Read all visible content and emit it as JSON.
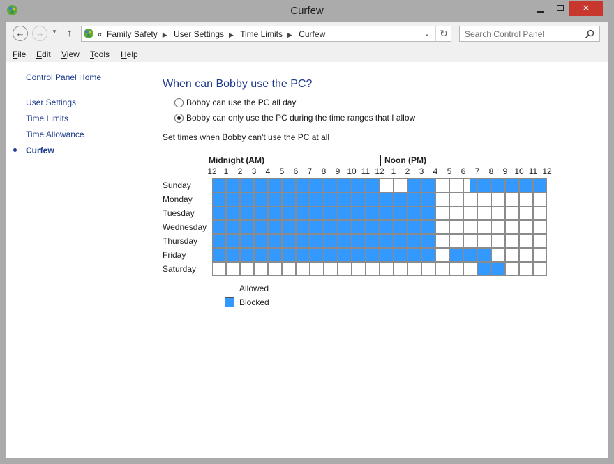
{
  "window": {
    "title": "Curfew"
  },
  "address_bar": {
    "breadcrumbs": [
      "«",
      "Family Safety",
      "User Settings",
      "Time Limits",
      "Curfew"
    ]
  },
  "search": {
    "placeholder": "Search Control Panel"
  },
  "menu": [
    {
      "key": "F",
      "rest": "ile"
    },
    {
      "key": "E",
      "rest": "dit"
    },
    {
      "key": "V",
      "rest": "iew"
    },
    {
      "key": "T",
      "rest": "ools"
    },
    {
      "key": "H",
      "rest": "elp"
    }
  ],
  "sidebar": {
    "home": "Control Panel Home",
    "items": [
      {
        "label": "User Settings",
        "active": false
      },
      {
        "label": "Time Limits",
        "active": false
      },
      {
        "label": "Time Allowance",
        "active": false
      },
      {
        "label": "Curfew",
        "active": true
      }
    ]
  },
  "main": {
    "heading": "When can Bobby use the PC?",
    "options": [
      {
        "label": "Bobby can use the PC all day",
        "selected": false
      },
      {
        "label": "Bobby can only use the PC during the time ranges that I allow",
        "selected": true
      }
    ],
    "instructions": "Set times when Bobby can't use the PC at all"
  },
  "schedule": {
    "am_label": "Midnight (AM)",
    "pm_label": "Noon (PM)",
    "hours": [
      "12",
      "1",
      "2",
      "3",
      "4",
      "5",
      "6",
      "7",
      "8",
      "9",
      "10",
      "11",
      "12",
      "1",
      "2",
      "3",
      "4",
      "5",
      "6",
      "7",
      "8",
      "9",
      "10",
      "11",
      "12"
    ],
    "days": [
      {
        "name": "Sunday",
        "blocked_hours": [
          0,
          1,
          2,
          3,
          4,
          5,
          6,
          7,
          8,
          9,
          10,
          11,
          14,
          15,
          18.5,
          19,
          20,
          21,
          22,
          23
        ]
      },
      {
        "name": "Monday",
        "blocked_hours": [
          0,
          1,
          2,
          3,
          4,
          5,
          6,
          7,
          8,
          9,
          10,
          11,
          12,
          13,
          14,
          15
        ]
      },
      {
        "name": "Tuesday",
        "blocked_hours": [
          0,
          1,
          2,
          3,
          4,
          5,
          6,
          7,
          8,
          9,
          10,
          11,
          12,
          13,
          14,
          15
        ]
      },
      {
        "name": "Wednesday",
        "blocked_hours": [
          0,
          1,
          2,
          3,
          4,
          5,
          6,
          7,
          8,
          9,
          10,
          11,
          12,
          13,
          14,
          15
        ]
      },
      {
        "name": "Thursday",
        "blocked_hours": [
          0,
          1,
          2,
          3,
          4,
          5,
          6,
          7,
          8,
          9,
          10,
          11,
          12,
          13,
          14,
          15
        ]
      },
      {
        "name": "Friday",
        "blocked_hours": [
          0,
          1,
          2,
          3,
          4,
          5,
          6,
          7,
          8,
          9,
          10,
          11,
          12,
          13,
          14,
          15,
          17,
          18,
          19
        ]
      },
      {
        "name": "Saturday",
        "blocked_hours": [
          19,
          20
        ]
      }
    ]
  },
  "legend": [
    {
      "label": "Allowed",
      "state": "allowed"
    },
    {
      "label": "Blocked",
      "state": "blocked"
    }
  ],
  "colors": {
    "blocked": "#3399ff",
    "link": "#1c3b8c",
    "heading": "#1e3a8a"
  }
}
